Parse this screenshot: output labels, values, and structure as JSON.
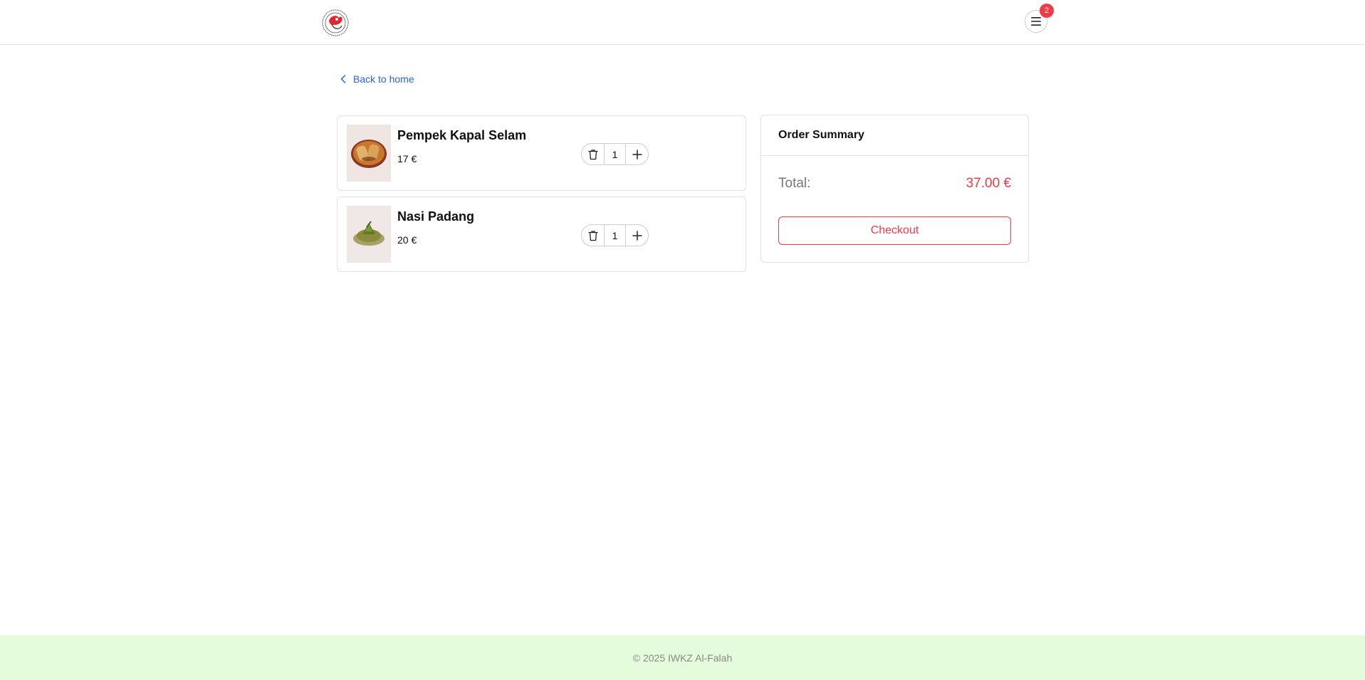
{
  "header": {
    "menu_badge_count": "2",
    "logo_icon": "restaurant-logo",
    "menu_icon": "hamburger-menu-icon"
  },
  "nav": {
    "back_label": "Back to home"
  },
  "cart": {
    "items": [
      {
        "name": "Pempek Kapal Selam",
        "price": "17 €",
        "quantity": "1",
        "image": "pempek-dish-image"
      },
      {
        "name": "Nasi Padang",
        "price": "20 €",
        "quantity": "1",
        "image": "nasi-padang-dish-image"
      }
    ]
  },
  "summary": {
    "title": "Order Summary",
    "total_label": "Total:",
    "total_value": "37.00 €",
    "checkout_label": "Checkout"
  },
  "footer": {
    "copyright": "© 2025 IWKZ Al-Falah"
  },
  "colors": {
    "accent_red": "#ef3b45",
    "link_blue": "#2563eb",
    "footer_bg": "#e4fcdc"
  }
}
